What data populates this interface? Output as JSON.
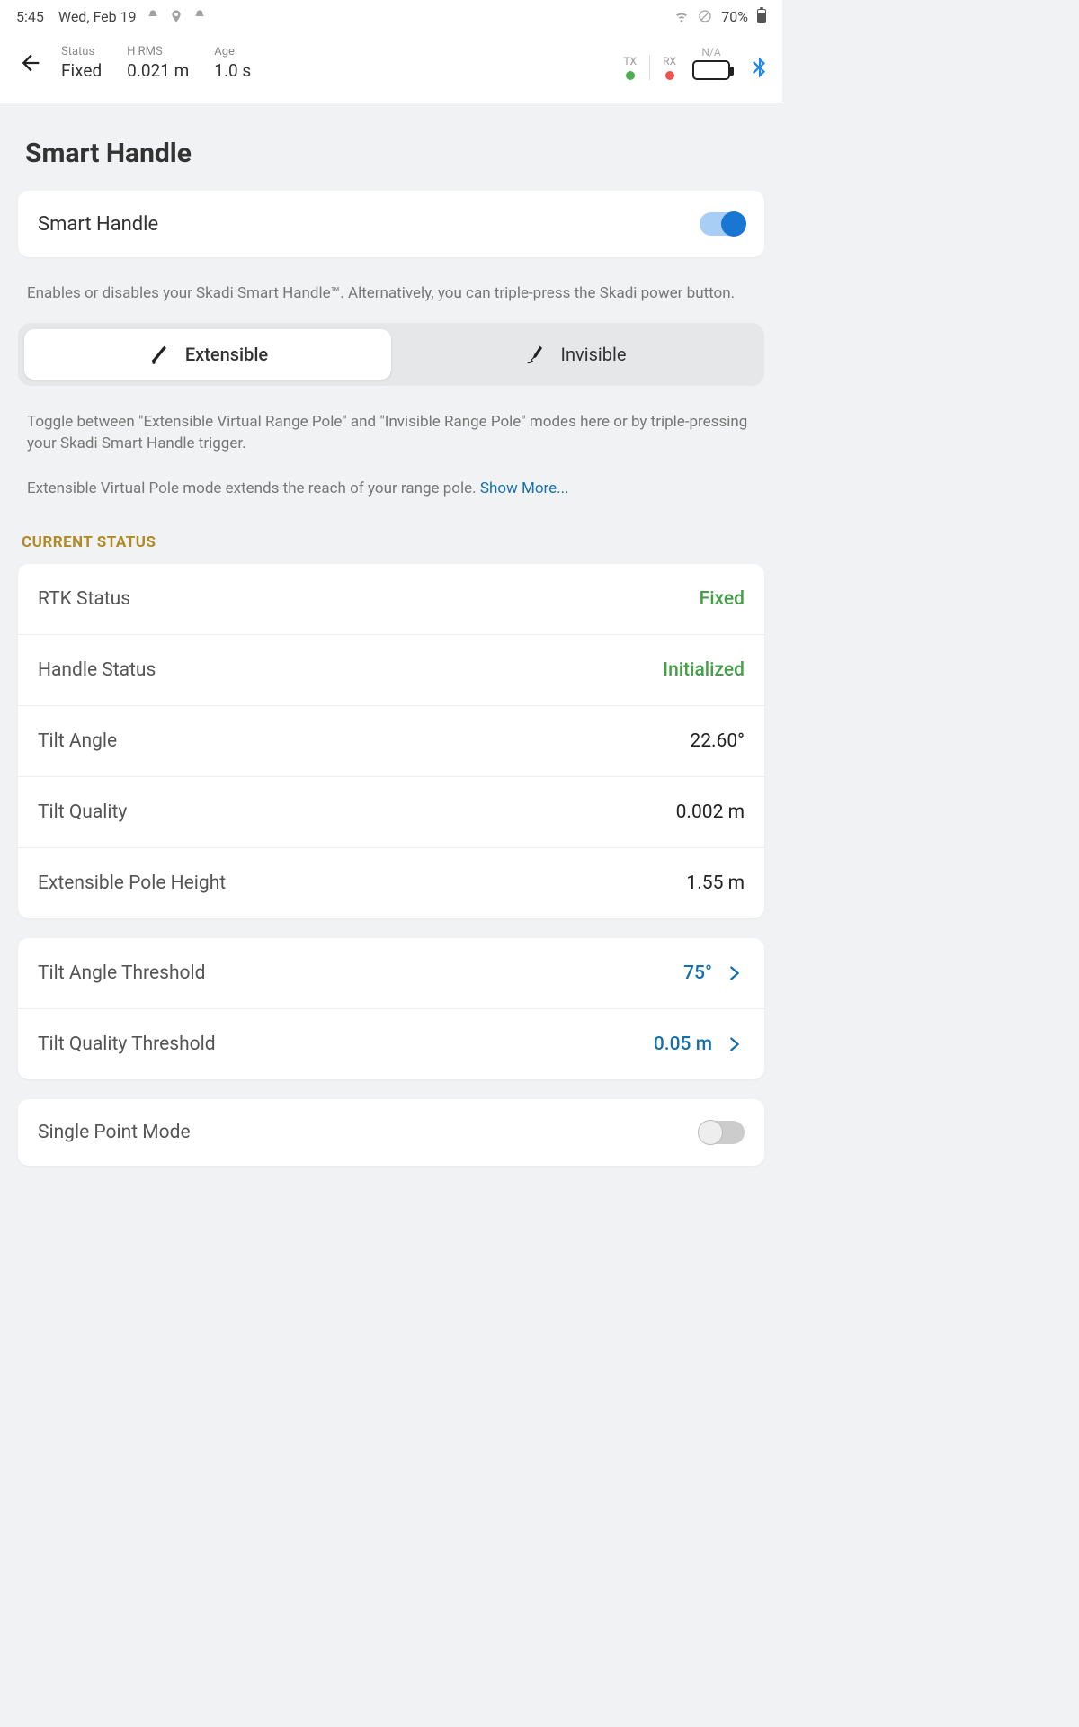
{
  "statusbar": {
    "time": "5:45",
    "date": "Wed, Feb 19",
    "battery_pct": "70%"
  },
  "header": {
    "status_label": "Status",
    "status_value": "Fixed",
    "hrms_label": "H RMS",
    "hrms_value": "0.021 m",
    "age_label": "Age",
    "age_value": "1.0 s",
    "tx_label": "TX",
    "rx_label": "RX",
    "battery_label": "N/A"
  },
  "page": {
    "title": "Smart Handle"
  },
  "toggle_card": {
    "label": "Smart Handle",
    "enabled": true,
    "help": "Enables or disables your Skadi Smart Handle™. Alternatively, you can triple-press the Skadi power button."
  },
  "segmented": {
    "option_a": "Extensible",
    "option_b": "Invisible",
    "help1": "Toggle between \"Extensible Virtual Range Pole\" and \"Invisible Range Pole\" modes here or by triple-pressing your Skadi Smart Handle trigger.",
    "help2_prefix": "Extensible Virtual Pole mode extends the reach of your range pole. ",
    "help2_link": "Show More..."
  },
  "status_section": {
    "header": "CURRENT STATUS",
    "rows": [
      {
        "label": "RTK Status",
        "value": "Fixed",
        "style": "green"
      },
      {
        "label": "Handle Status",
        "value": "Initialized",
        "style": "green"
      },
      {
        "label": "Tilt Angle",
        "value": "22.60°",
        "style": "normal"
      },
      {
        "label": "Tilt Quality",
        "value": "0.002 m",
        "style": "normal"
      },
      {
        "label": "Extensible Pole Height",
        "value": "1.55 m",
        "style": "normal"
      }
    ]
  },
  "thresholds": {
    "rows": [
      {
        "label": "Tilt Angle Threshold",
        "value": "75°"
      },
      {
        "label": "Tilt Quality Threshold",
        "value": "0.05 m"
      }
    ]
  },
  "partial": {
    "label": "Single Point Mode"
  }
}
